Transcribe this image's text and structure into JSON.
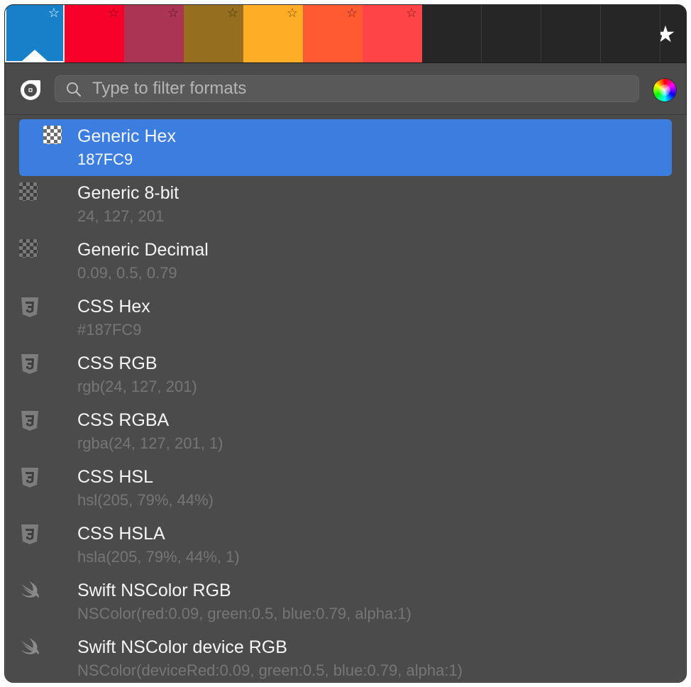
{
  "swatches": [
    {
      "color": "#187FC9",
      "selected": true
    },
    {
      "color": "#F7002A",
      "selected": false
    },
    {
      "color": "#AA3451",
      "selected": false
    },
    {
      "color": "#956F1F",
      "selected": false
    },
    {
      "color": "#FEAD26",
      "selected": false
    },
    {
      "color": "#FF5A31",
      "selected": false
    },
    {
      "color": "#FF4447",
      "selected": false
    }
  ],
  "empty_swatch_count": 4,
  "search": {
    "placeholder": "Type to filter formats",
    "value": ""
  },
  "formats": [
    {
      "title": "Generic Hex",
      "value": "187FC9",
      "icon": "checkerboard-icon",
      "selected": true
    },
    {
      "title": "Generic 8-bit",
      "value": "24, 127, 201",
      "icon": "checkerboard-icon",
      "selected": false
    },
    {
      "title": "Generic Decimal",
      "value": "0.09, 0.5, 0.79",
      "icon": "checkerboard-icon",
      "selected": false
    },
    {
      "title": "CSS Hex",
      "value": "#187FC9",
      "icon": "css3-icon",
      "selected": false
    },
    {
      "title": "CSS RGB",
      "value": "rgb(24, 127, 201)",
      "icon": "css3-icon",
      "selected": false
    },
    {
      "title": "CSS RGBA",
      "value": "rgba(24, 127, 201, 1)",
      "icon": "css3-icon",
      "selected": false
    },
    {
      "title": "CSS HSL",
      "value": "hsl(205, 79%, 44%)",
      "icon": "css3-icon",
      "selected": false
    },
    {
      "title": "CSS HSLA",
      "value": "hsla(205, 79%, 44%, 1)",
      "icon": "css3-icon",
      "selected": false
    },
    {
      "title": "Swift NSColor RGB",
      "value": "NSColor(red:0.09, green:0.5, blue:0.79, alpha:1)",
      "icon": "swift-icon",
      "selected": false
    },
    {
      "title": "Swift NSColor device RGB",
      "value": "NSColor(deviceRed:0.09, green:0.5, blue:0.79, alpha:1)",
      "icon": "swift-icon",
      "selected": false
    }
  ],
  "colors": {
    "selection": "#3C7DE0",
    "background": "#4B4B4B",
    "muted_text": "#767676"
  }
}
